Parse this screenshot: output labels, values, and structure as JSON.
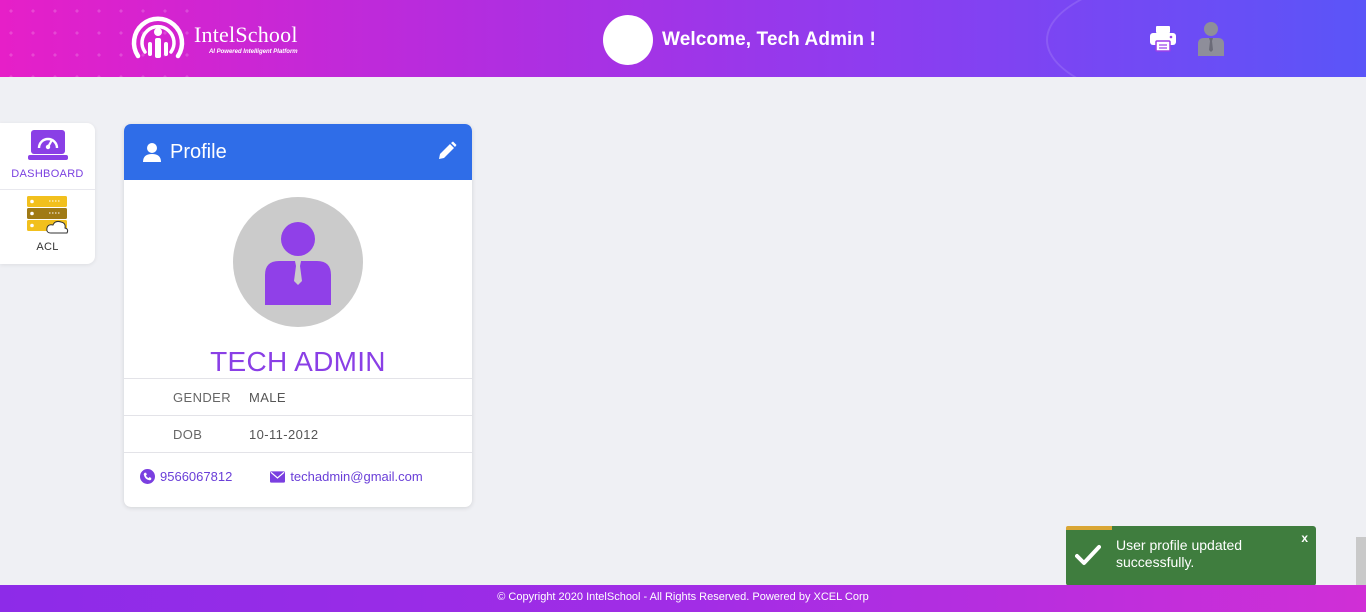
{
  "header": {
    "logo_title": "IntelSchool",
    "logo_tagline": "AI Powered Intelligent Platform",
    "welcome_text": "Welcome, Tech Admin !"
  },
  "sidenav": {
    "items": [
      {
        "label": "DASHBOARD",
        "icon": "dashboard-icon"
      },
      {
        "label": "ACL",
        "icon": "server-cloud-icon"
      }
    ]
  },
  "profile": {
    "title": "Profile",
    "name": "TECH ADMIN",
    "rows": [
      {
        "key": "GENDER",
        "value": "MALE"
      },
      {
        "key": "DOB",
        "value": "10-11-2012"
      }
    ],
    "phone": "9566067812",
    "email": "techadmin@gmail.com"
  },
  "toast": {
    "message": "User profile updated successfully.",
    "close": "x"
  },
  "footer": {
    "text": "© Copyright 2020 IntelSchool - All Rights Reserved. Powered by XCEL Corp"
  },
  "colors": {
    "primary_blue": "#2f6de8",
    "accent_purple": "#8a3fe6",
    "toast_green": "#3f7d3e"
  }
}
